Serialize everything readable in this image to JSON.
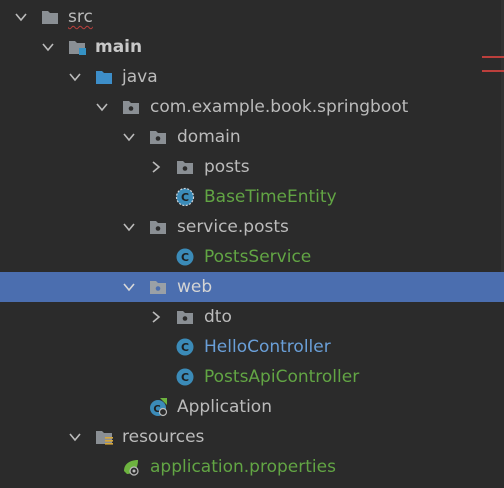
{
  "tree": {
    "nodes": [
      {
        "label": "src",
        "icon": "folder-icon",
        "expanded": true
      },
      {
        "label": "main",
        "icon": "source-root-folder-icon",
        "expanded": true
      },
      {
        "label": "java",
        "icon": "java-source-folder-icon",
        "expanded": true
      },
      {
        "label": "com.example.book.springboot",
        "icon": "package-icon",
        "expanded": true
      },
      {
        "label": "domain",
        "icon": "package-icon",
        "expanded": true
      },
      {
        "label": "posts",
        "icon": "package-icon",
        "expanded": false
      },
      {
        "label": "BaseTimeEntity",
        "icon": "abstract-class-icon"
      },
      {
        "label": "service.posts",
        "icon": "package-icon",
        "expanded": true
      },
      {
        "label": "PostsService",
        "icon": "class-icon"
      },
      {
        "label": "web",
        "icon": "package-icon",
        "expanded": true,
        "selected": true
      },
      {
        "label": "dto",
        "icon": "package-icon",
        "expanded": false
      },
      {
        "label": "HelloController",
        "icon": "class-icon"
      },
      {
        "label": "PostsApiController",
        "icon": "class-icon"
      },
      {
        "label": "Application",
        "icon": "spring-boot-app-icon"
      },
      {
        "label": "resources",
        "icon": "resources-folder-icon",
        "expanded": true
      },
      {
        "label": "application.properties",
        "icon": "spring-properties-icon"
      }
    ]
  },
  "colors": {
    "background": "#2b2b2b",
    "selection": "#4b6eaf",
    "text": "#bbbbbb",
    "modified_green": "#62a544",
    "modified_blue": "#6a9fd8",
    "error_red": "#bc3f3c"
  }
}
